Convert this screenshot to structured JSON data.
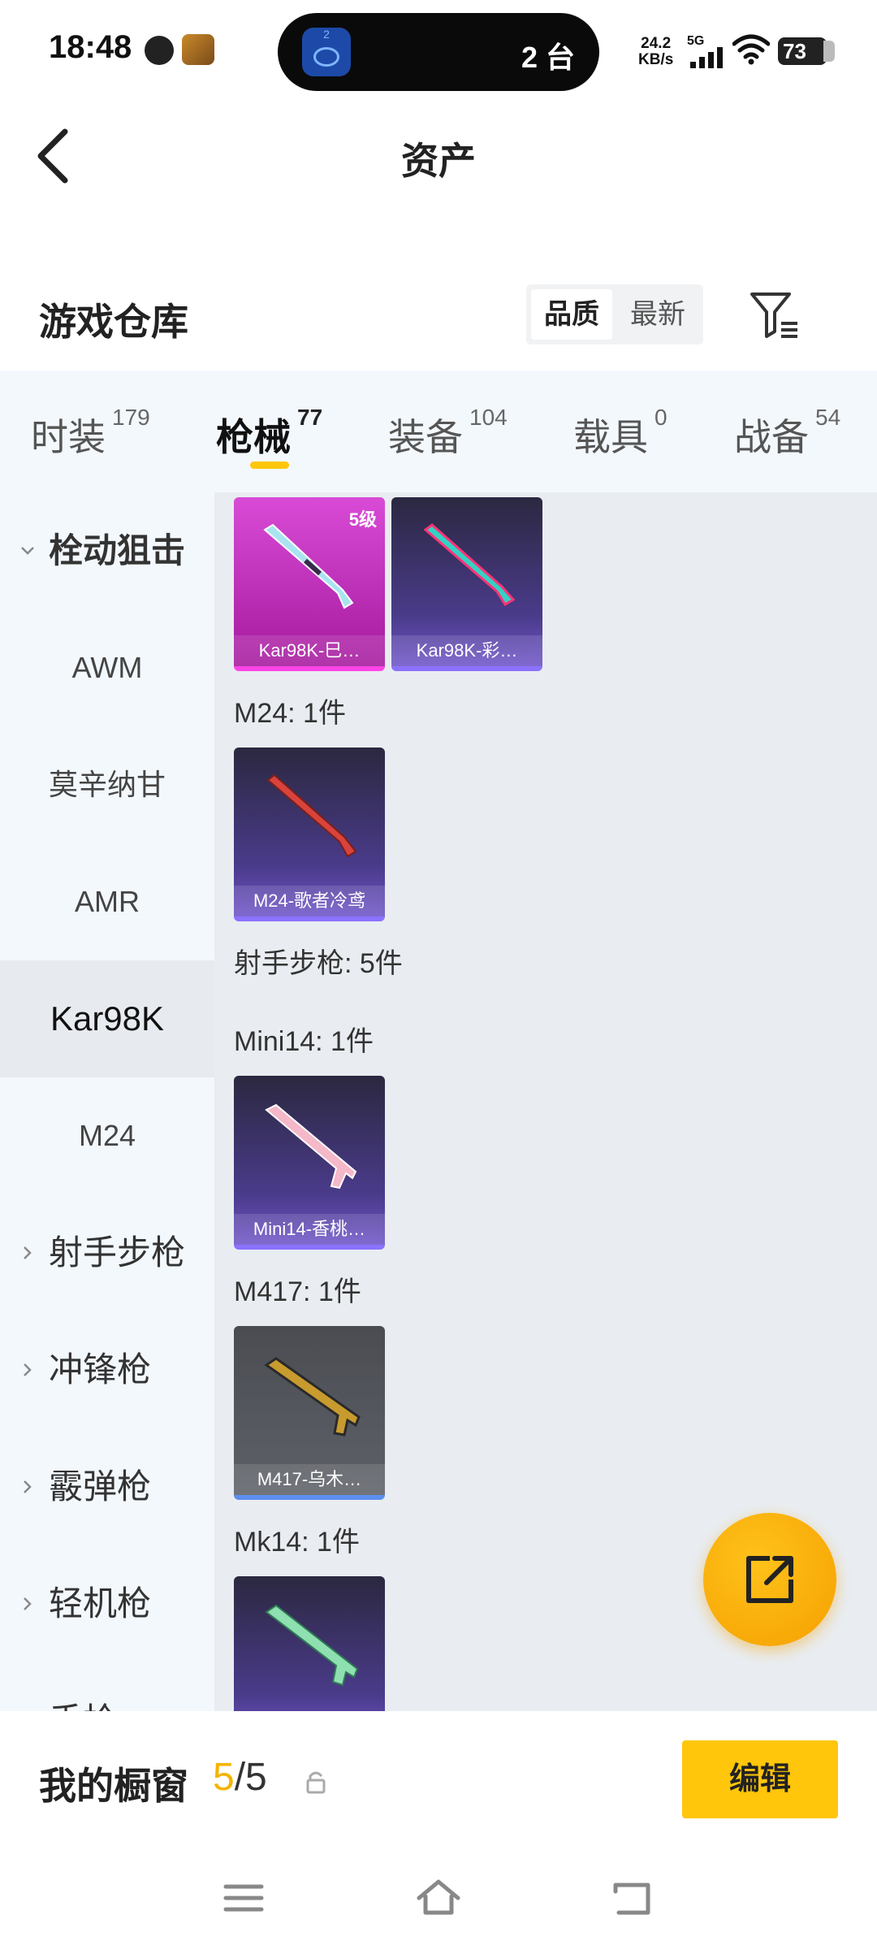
{
  "status": {
    "time": "18:48",
    "island_badge": "2",
    "island_text": "2 台",
    "net_speed_value": "24.2",
    "net_speed_unit": "KB/s",
    "network": "5G",
    "battery": "73"
  },
  "header": {
    "title": "资产"
  },
  "warehouse": {
    "title": "游戏仓库",
    "sort_options": [
      "品质",
      "最新"
    ]
  },
  "tabs": [
    {
      "label": "时装",
      "count": "179"
    },
    {
      "label": "枪械",
      "count": "77"
    },
    {
      "label": "装备",
      "count": "104"
    },
    {
      "label": "载具",
      "count": "0"
    },
    {
      "label": "战备",
      "count": "54"
    }
  ],
  "sidebar": {
    "group_open": "栓动狙击",
    "items": [
      "AWM",
      "莫辛纳甘",
      "AMR",
      "Kar98K",
      "M24"
    ],
    "groups": [
      "射手步枪",
      "冲锋枪",
      "霰弹枪",
      "轻机枪",
      "手枪"
    ]
  },
  "content": {
    "cards_kar": [
      {
        "name": "Kar98K-巳…",
        "level": "5级",
        "rarity": "pink"
      },
      {
        "name": "Kar98K-彩…",
        "rarity": "purple"
      }
    ],
    "label_m24": "M24: 1件",
    "card_m24": {
      "name": "M24-歌者冷鸢"
    },
    "label_dmr": "射手步枪: 5件",
    "label_mini14": "Mini14: 1件",
    "card_mini14": {
      "name": "Mini14-香桃…"
    },
    "label_m417": "M417: 1件",
    "card_m417": {
      "name": "M417-乌木…"
    },
    "label_mk14": "Mk14: 1件"
  },
  "bottom": {
    "showcase_label": "我的橱窗",
    "showcase_current": "5",
    "showcase_total": "/5",
    "edit_label": "编辑"
  },
  "colors": {
    "accent": "#ffc60b",
    "fab": "#f5a000",
    "pink_rarity": "#d94bd6",
    "purple_rarity": "#4a3b8a"
  }
}
